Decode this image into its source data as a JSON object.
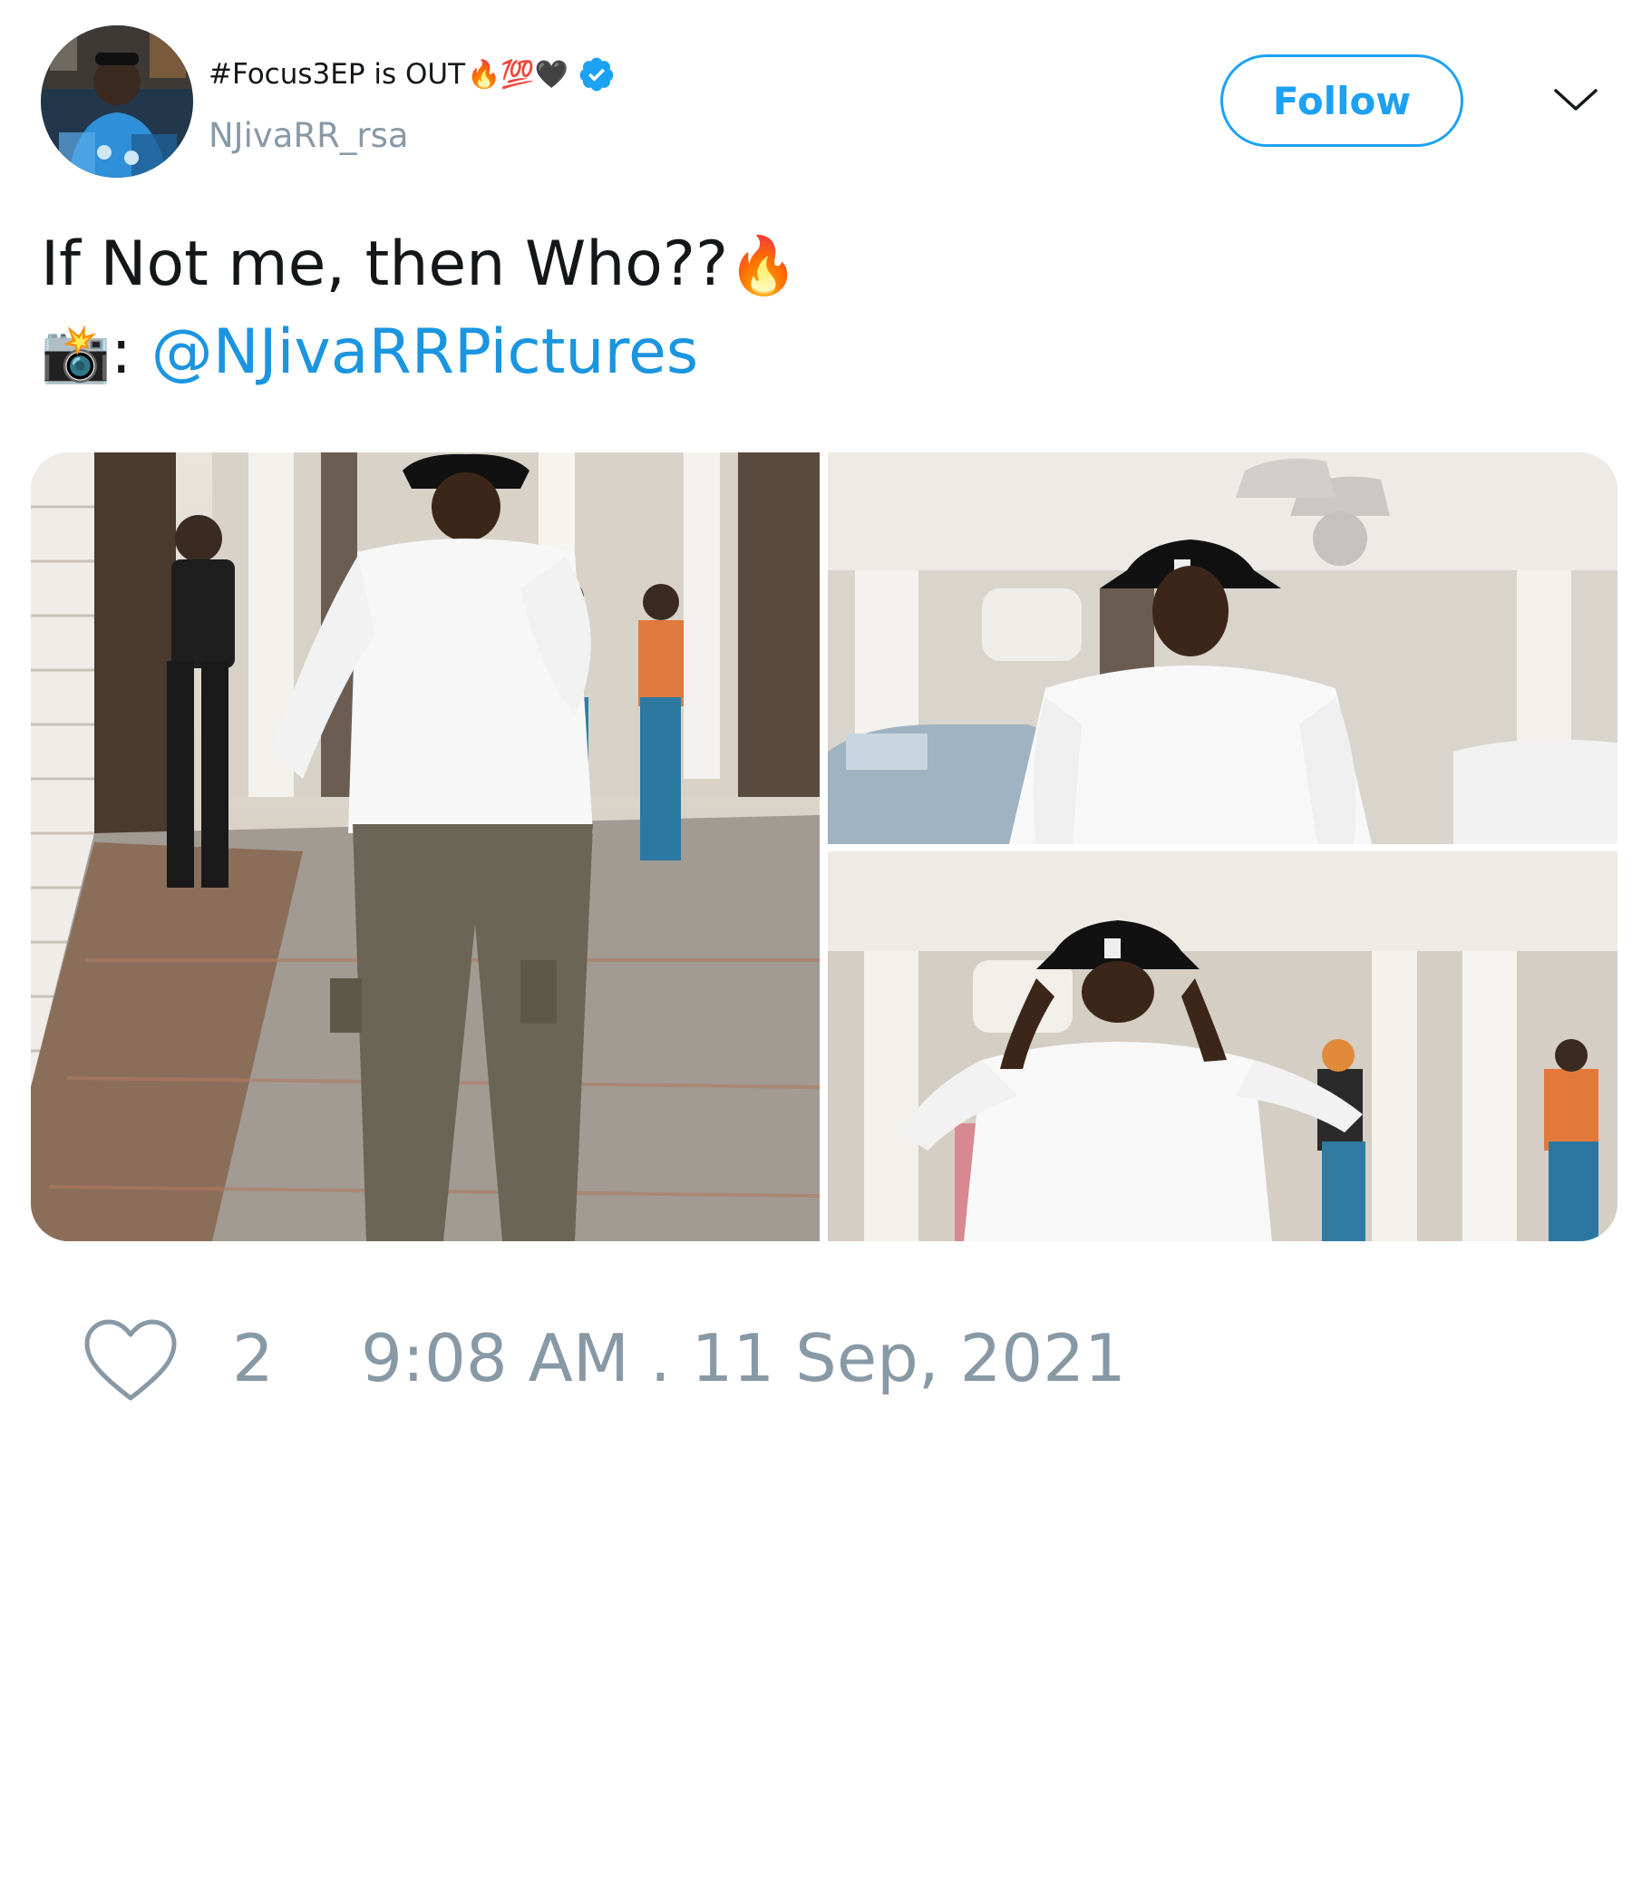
{
  "header": {
    "display_name": "#Focus3EP is OUT",
    "display_name_emoji": "🔥💯🖤",
    "verified": true,
    "handle": "NJivaRR_rsa",
    "follow_label": "Follow",
    "accent_color": "#1da1f2"
  },
  "tweet": {
    "line1_text": "If Not me, then Who??",
    "line1_emoji": "🔥",
    "line2_emoji": "📸",
    "line2_separator": ": ",
    "mention": "@NJivaRRPictures"
  },
  "media": {
    "count": 3,
    "photos": [
      {
        "icon": "photo-man-standing-full-body"
      },
      {
        "icon": "photo-man-bucket-hat-closeup"
      },
      {
        "icon": "photo-man-adjusting-hat"
      }
    ]
  },
  "footer": {
    "like_icon": "heart-outline-icon",
    "like_count": "2",
    "timestamp": "9:08 AM . 11 Sep, 2021"
  },
  "colors": {
    "text": "#14171a",
    "muted": "#8899a6",
    "link": "#1b95e0"
  }
}
